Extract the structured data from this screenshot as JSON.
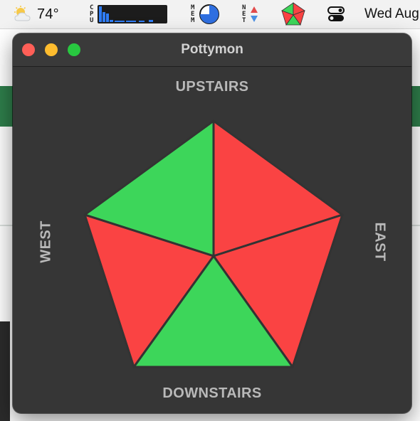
{
  "menubar": {
    "weather_temp": "74°",
    "cpu_label": [
      "C",
      "P",
      "U"
    ],
    "mem_label": [
      "M",
      "E",
      "M"
    ],
    "net_label": [
      "N",
      "E",
      "T"
    ],
    "date": "Wed Aug"
  },
  "window": {
    "title": "Pottymon"
  },
  "labels": {
    "up": "UPSTAIRS",
    "down": "DOWNSTAIRS",
    "west": "WEST",
    "east": "EAST"
  },
  "colors": {
    "green": "#3dd65a",
    "red": "#fa4343",
    "stroke": "#333333"
  },
  "segments": [
    {
      "name": "segment-upper-left",
      "status": "green"
    },
    {
      "name": "segment-upper-right",
      "status": "red"
    },
    {
      "name": "segment-right",
      "status": "red"
    },
    {
      "name": "segment-bottom",
      "status": "green"
    },
    {
      "name": "segment-left",
      "status": "red"
    }
  ]
}
